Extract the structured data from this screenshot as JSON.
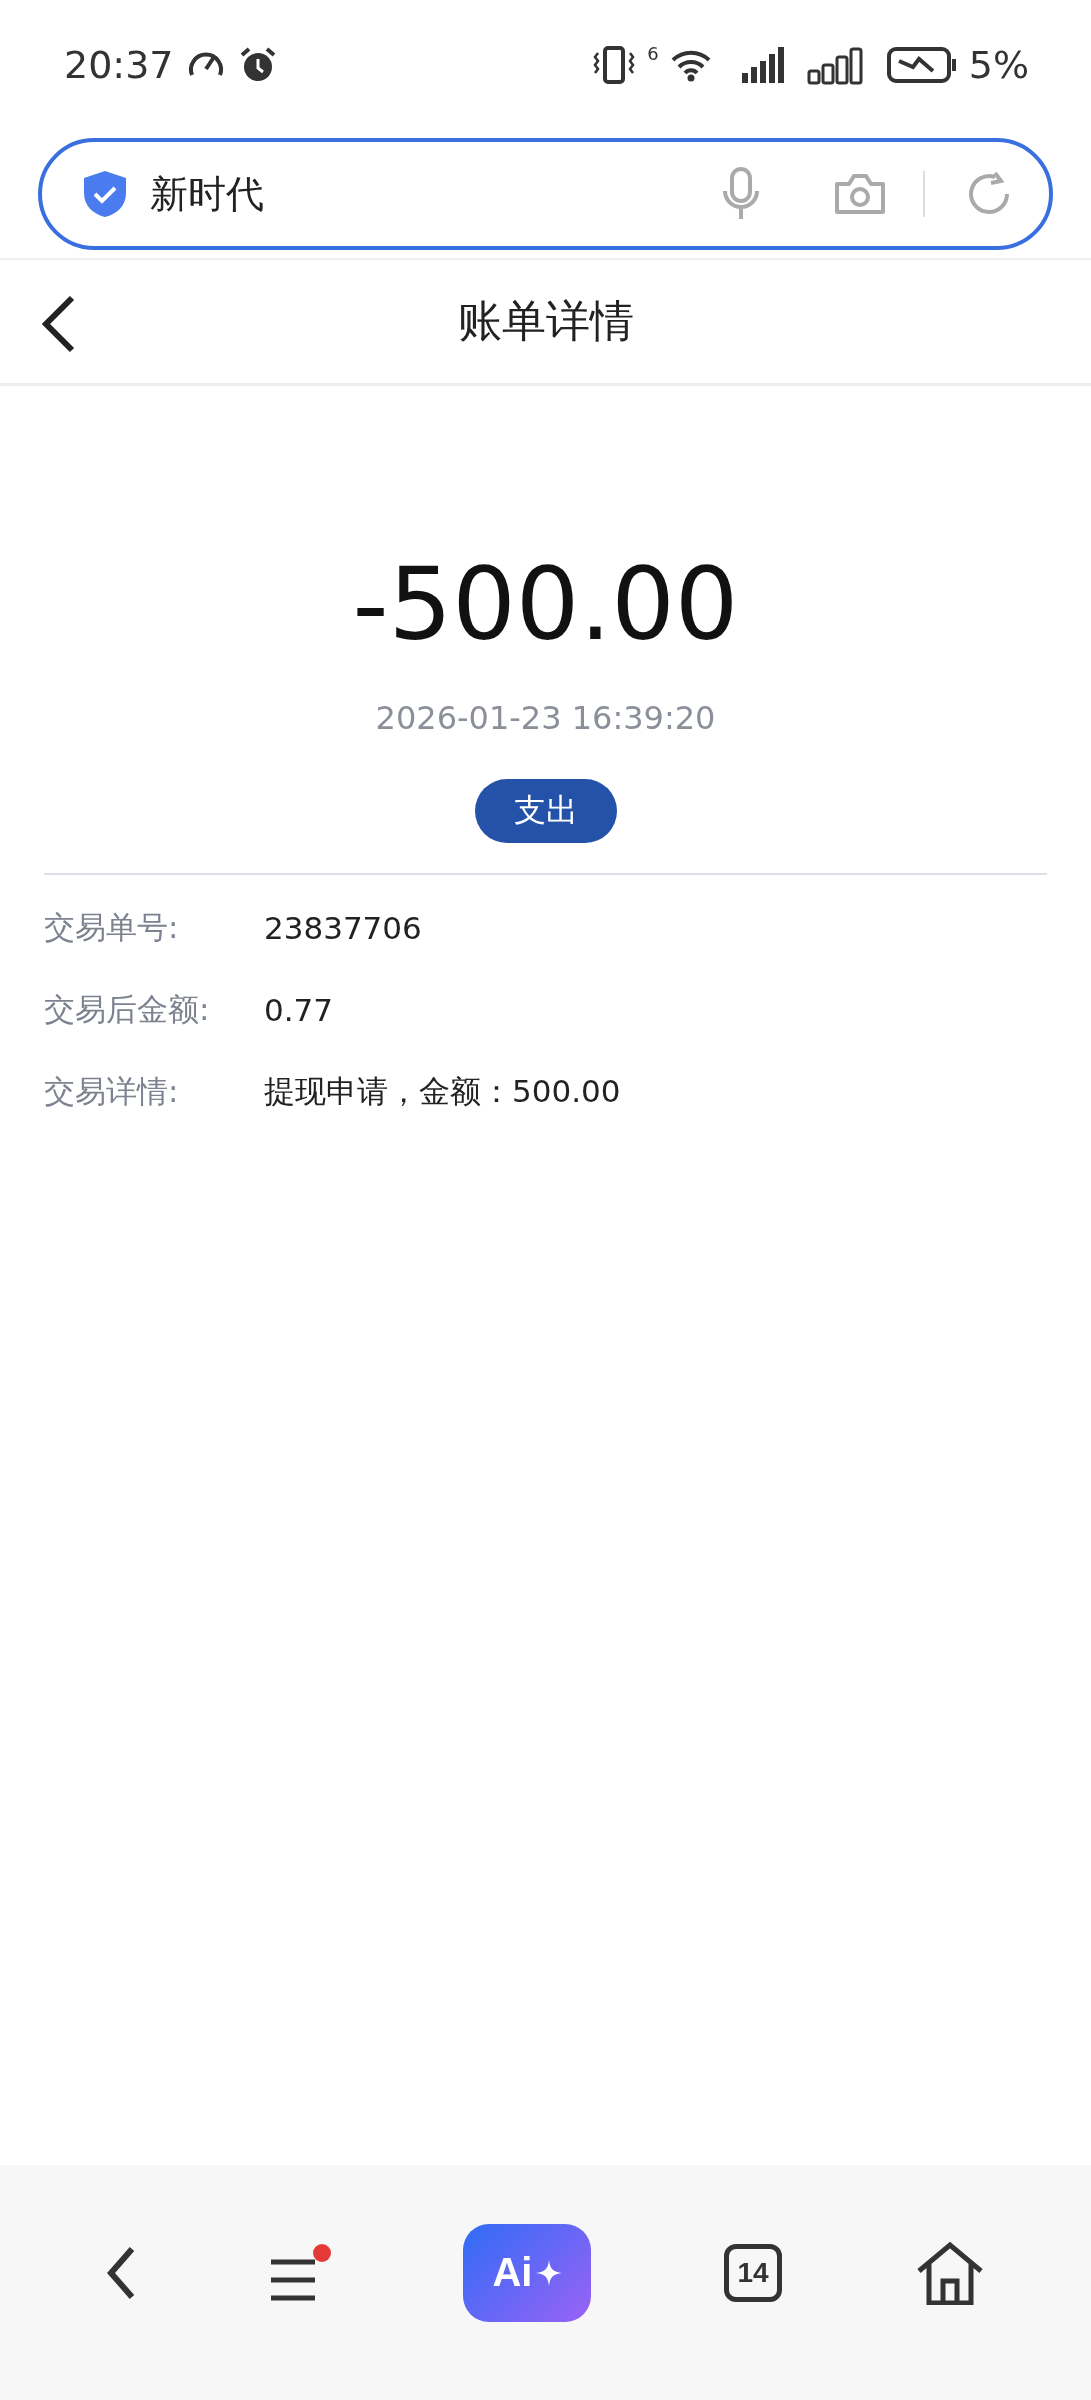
{
  "status_bar": {
    "time": "20:37",
    "wifi_badge": "6",
    "battery": "5%"
  },
  "address_bar": {
    "value": "新时代"
  },
  "header": {
    "title": "账单详情"
  },
  "bill": {
    "amount": "-500.00",
    "time": "2026-01-23 16:39:20",
    "type_badge": "支出"
  },
  "details": [
    {
      "label": "交易单号:",
      "value": "23837706"
    },
    {
      "label": "交易后金额:",
      "value": "0.77"
    },
    {
      "label": "交易详情:",
      "value": "提现申请，金额：500.00"
    }
  ],
  "bottom_nav": {
    "ai_label": "Ai",
    "tab_count": "14",
    "menu_has_notification": true
  }
}
